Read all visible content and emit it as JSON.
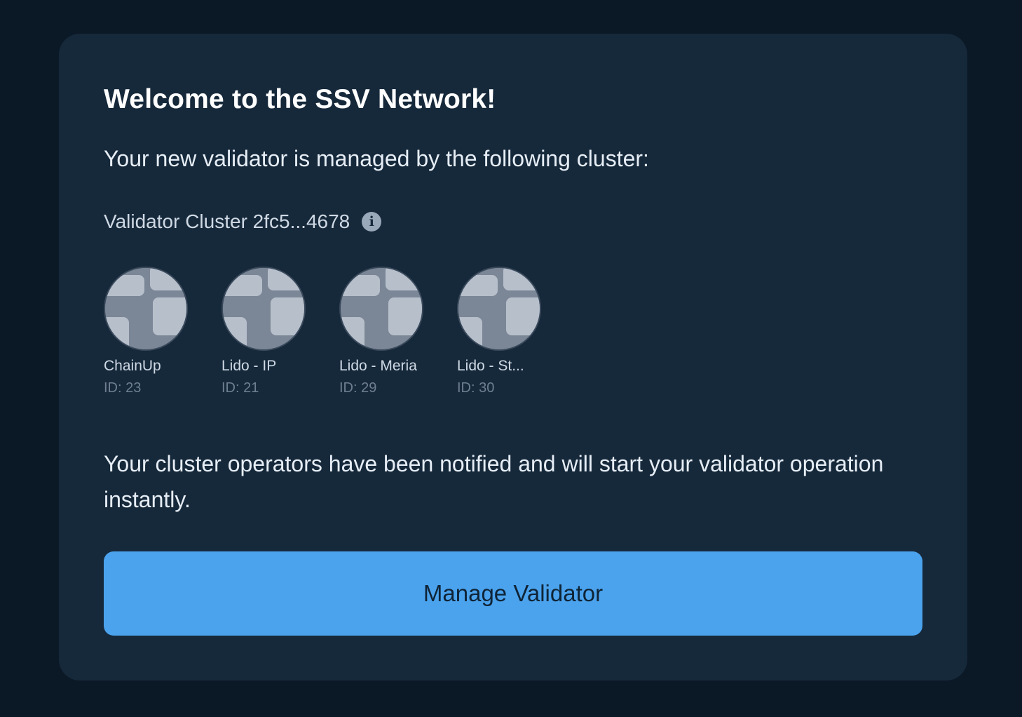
{
  "welcome": {
    "title": "Welcome to the SSV Network!",
    "subtitle": "Your new validator is managed by the following cluster:"
  },
  "cluster": {
    "label": "Validator Cluster 2fc5...4678",
    "info_icon": "info-icon"
  },
  "operators": [
    {
      "name": "ChainUp",
      "id": "ID: 23"
    },
    {
      "name": "Lido - IP",
      "id": "ID: 21"
    },
    {
      "name": "Lido - Meria",
      "id": "ID: 29"
    },
    {
      "name": "Lido - St...",
      "id": "ID: 30"
    }
  ],
  "notice": "Your cluster operators have been notified and will start your validator operation instantly.",
  "actions": {
    "manage_label": "Manage Validator"
  },
  "colors": {
    "background": "#0b1826",
    "card": "#16293b",
    "button": "#4ba3ee"
  }
}
